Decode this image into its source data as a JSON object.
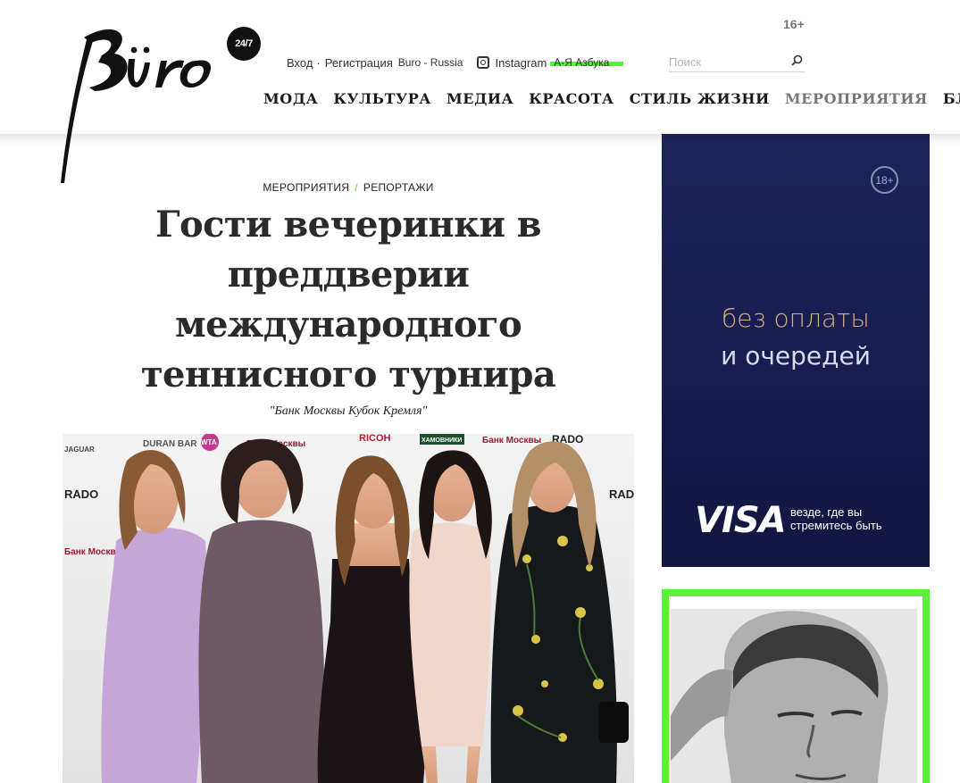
{
  "header": {
    "logo_text": "Büro",
    "logo_badge": "24/7",
    "age_rating": "16+",
    "login": "Вход",
    "register": "Регистрация",
    "region": "Buro - Russia",
    "instagram": "Instagram",
    "abc": "А-Я Азбука",
    "search_placeholder": "Поиск"
  },
  "nav": {
    "items": [
      {
        "label": "МОДА"
      },
      {
        "label": "КУЛЬТУРА"
      },
      {
        "label": "МЕДИА"
      },
      {
        "label": "КРАСОТА"
      },
      {
        "label": "СТИЛЬ ЖИЗНИ"
      },
      {
        "label": "МЕРОПРИЯТИЯ"
      },
      {
        "label": "БЛОГИ"
      }
    ]
  },
  "article": {
    "category": "МЕРОПРИЯТИЯ",
    "subcategory": "РЕПОРТАЖИ",
    "separator": "/",
    "title": "Гости вечеринки в преддверии международного теннисного турнира",
    "subtitle": "\"Банк Москвы Кубок Кремля\"",
    "photo_wall_logos": [
      "DURAN BAR",
      "WTA",
      "Банк Москвы",
      "RICOH",
      "ХАМОВНИКИ",
      "Банк Москвы",
      "RADO",
      "JAGUAR",
      "RADO",
      "Банк Москвы",
      "RADO"
    ]
  },
  "ad": {
    "age": "18+",
    "line1": "без оплаты",
    "line2": "и очередей",
    "brand": "VISA",
    "slogan": "везде, где вы стремитесь быть"
  },
  "colors": {
    "accent_green": "#5cf03a",
    "ad_navy": "#1b1f54",
    "ad_gold": "#d6b27a",
    "nav_muted": "#777777"
  }
}
